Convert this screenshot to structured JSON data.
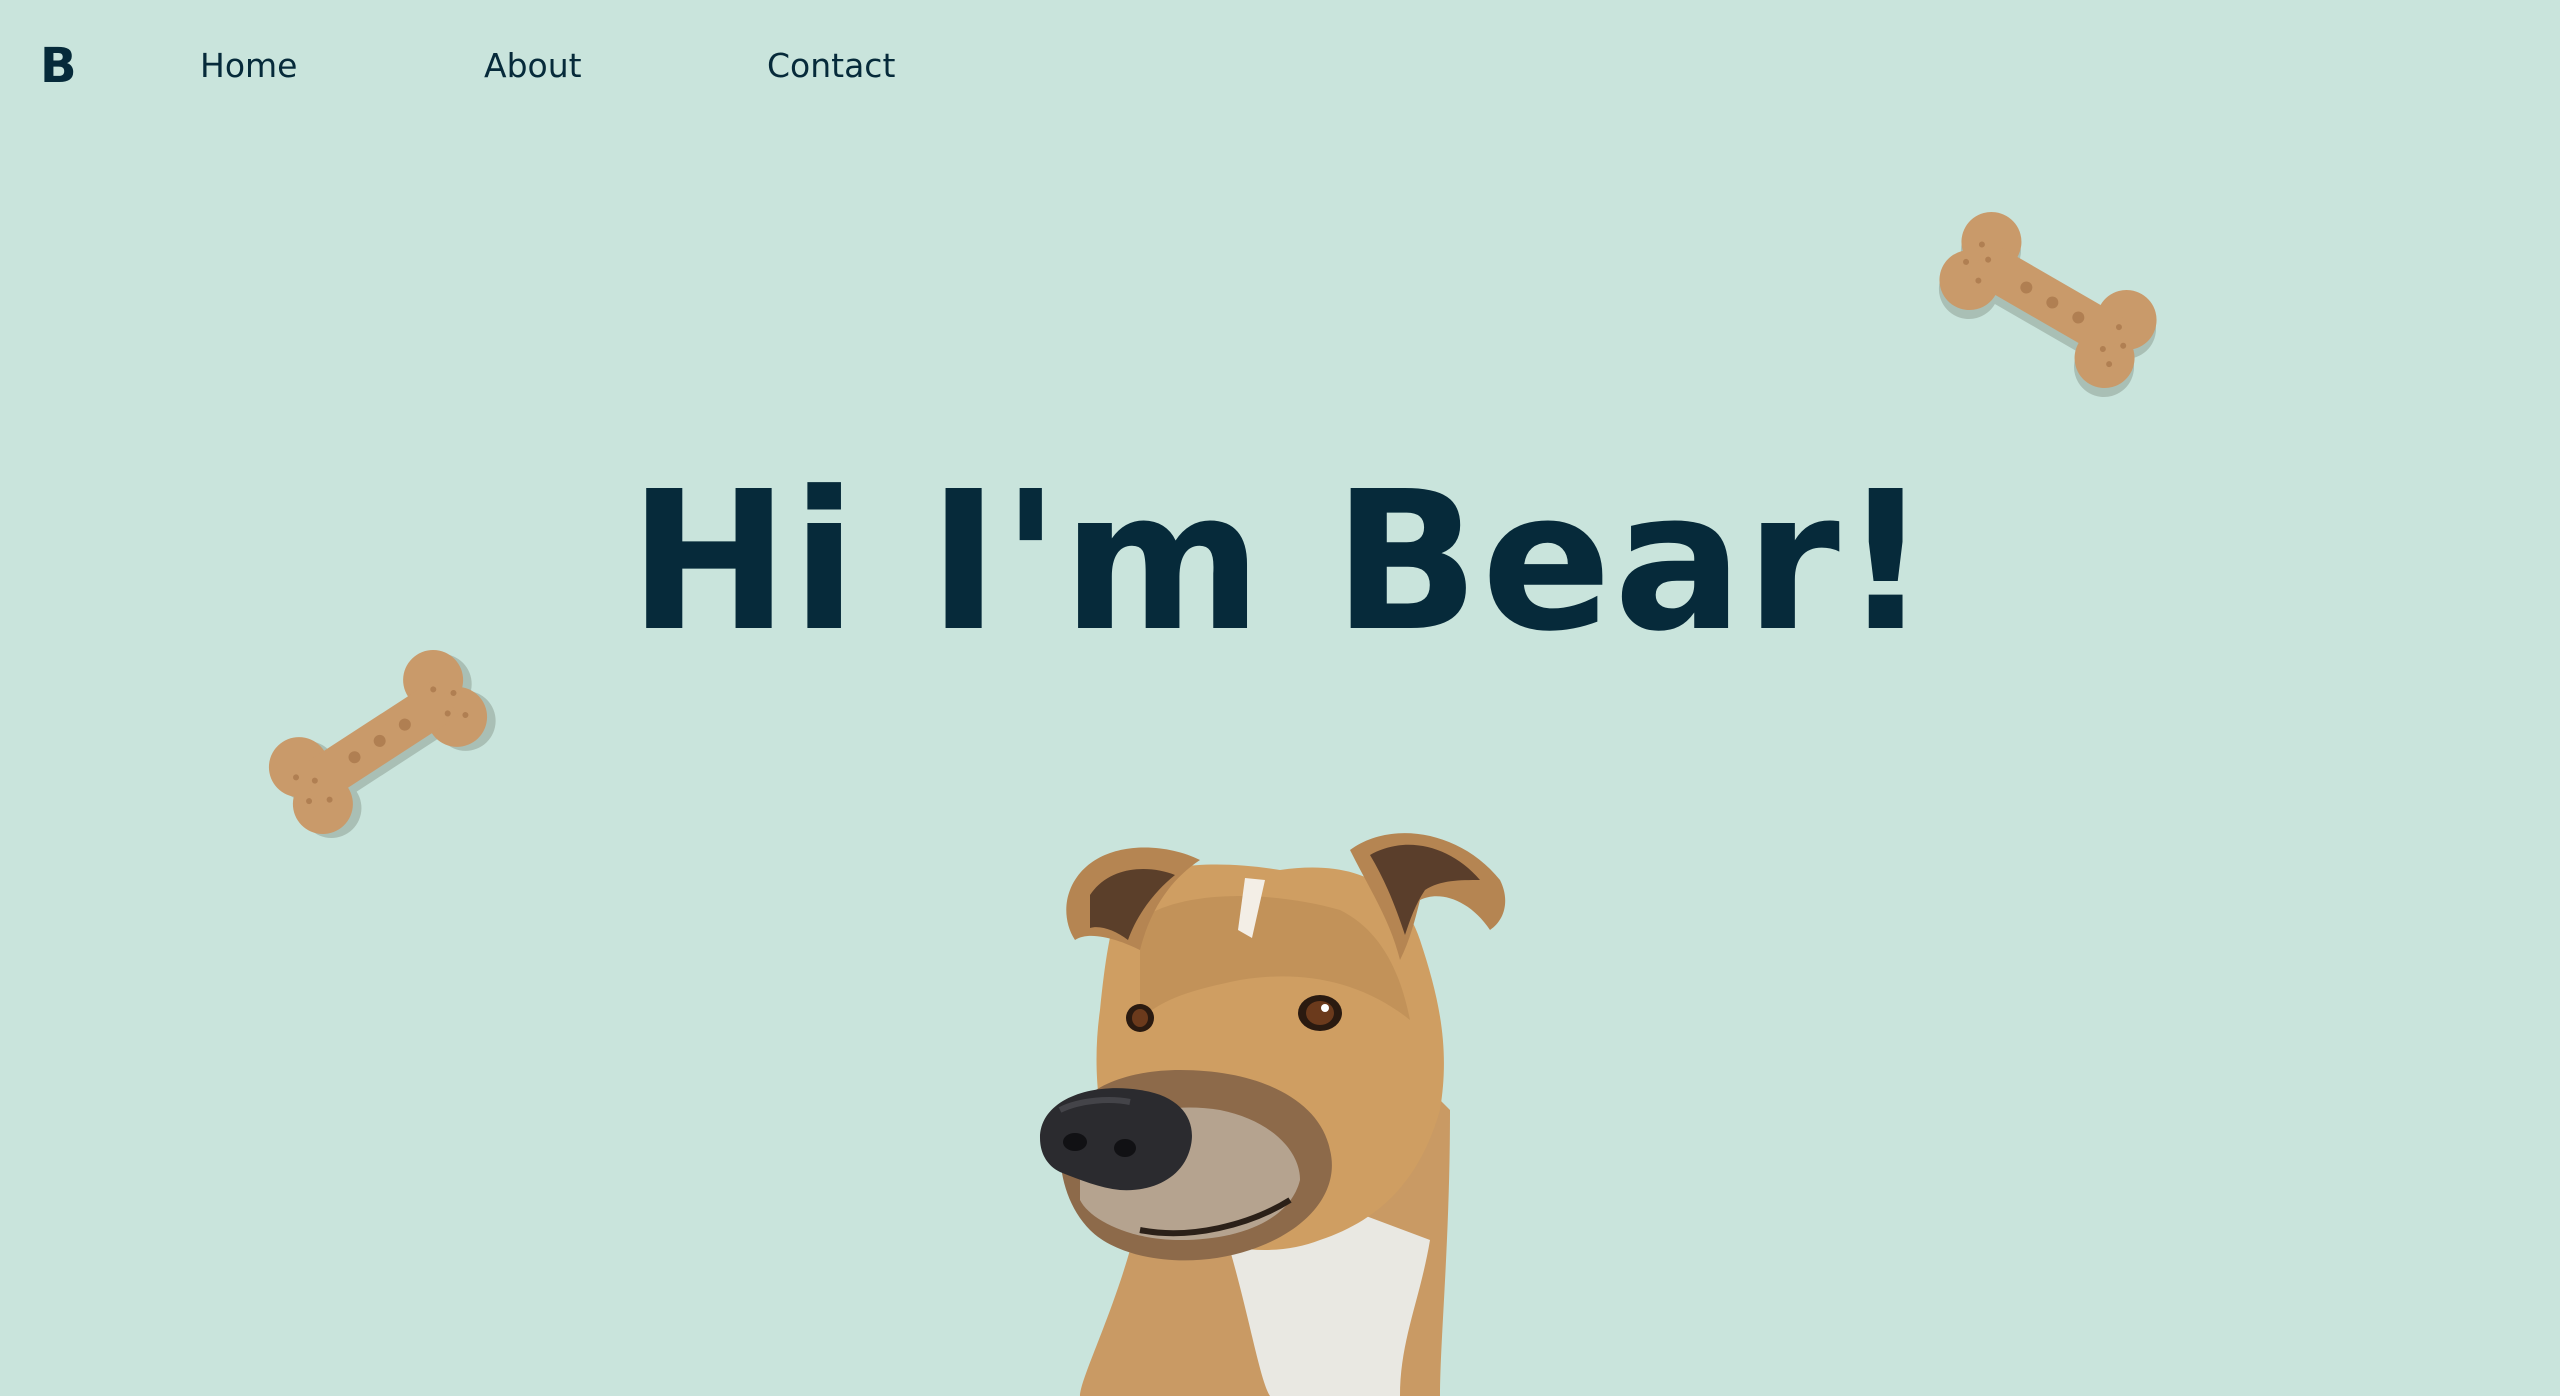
{
  "nav": {
    "logo": "B",
    "links": [
      {
        "label": "Home"
      },
      {
        "label": "About"
      },
      {
        "label": "Contact"
      }
    ]
  },
  "hero": {
    "title": "Hi I'm Bear!"
  },
  "colors": {
    "background": "#c9e4dc",
    "text": "#062a3a",
    "bone": "#c99a6a",
    "bone_shadow": "#a9b9ac"
  },
  "images": {
    "decorations": [
      "dog-bone-icon",
      "dog-bone-icon"
    ],
    "photo": "dog-photo"
  }
}
